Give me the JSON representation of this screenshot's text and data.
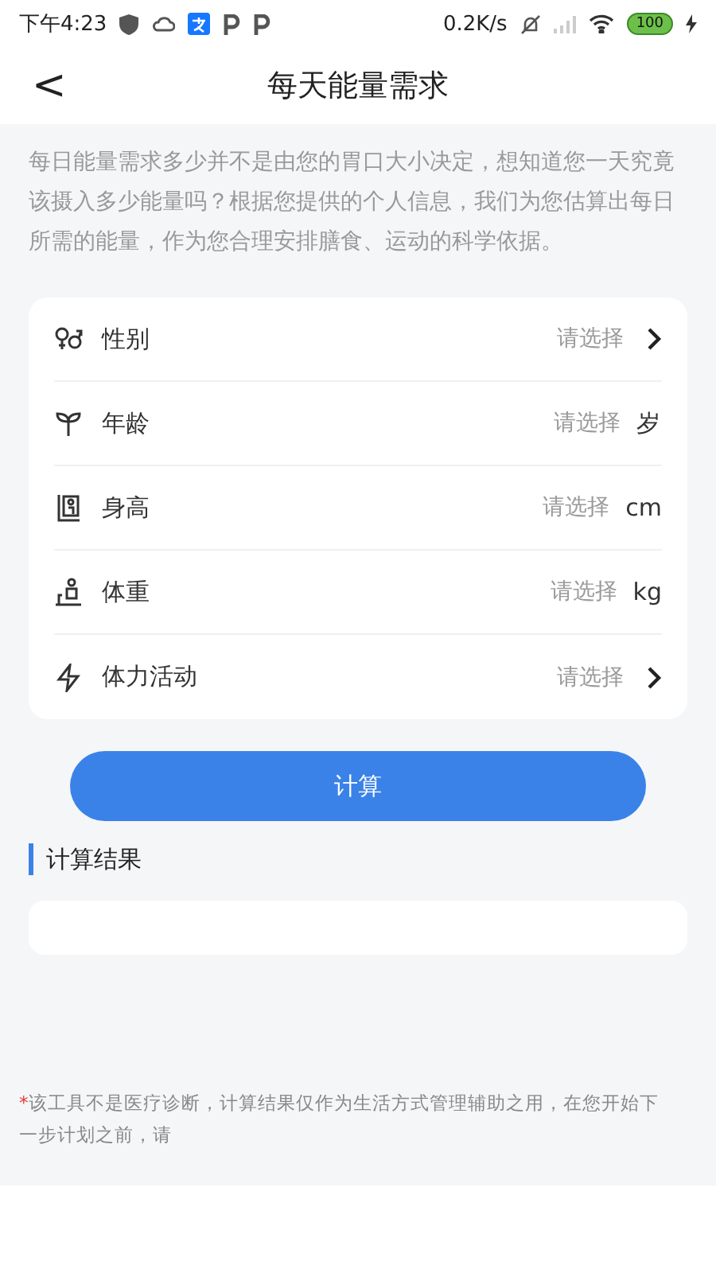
{
  "status_bar": {
    "time": "下午4:23",
    "speed": "0.2K/s",
    "battery": "100"
  },
  "header": {
    "back": "<",
    "title": "每天能量需求"
  },
  "intro": "每日能量需求多少并不是由您的胃口大小决定，想知道您一天究竟该摄入多少能量吗？根据您提供的个人信息，我们为您估算出每日所需的能量，作为您合理安排膳食、运动的科学依据。",
  "form": [
    {
      "kind": "select",
      "label": "性别",
      "placeholder": "请选择"
    },
    {
      "kind": "unit",
      "label": "年龄",
      "placeholder": "请选择",
      "unit": "岁"
    },
    {
      "kind": "unit",
      "label": "身高",
      "placeholder": "请选择",
      "unit": "cm"
    },
    {
      "kind": "unit",
      "label": "体重",
      "placeholder": "请选择",
      "unit": "kg"
    },
    {
      "kind": "select",
      "label": "体力活动",
      "placeholder": "请选择"
    }
  ],
  "calculate_button": "计算",
  "result": {
    "title": "计算结果"
  },
  "disclaimer": {
    "mark": "*",
    "lines": [
      "该工具不是医疗诊断，计算结果仅作为生活方式管理辅助之用，在您开始下",
      "一步计划之前，请"
    ]
  }
}
